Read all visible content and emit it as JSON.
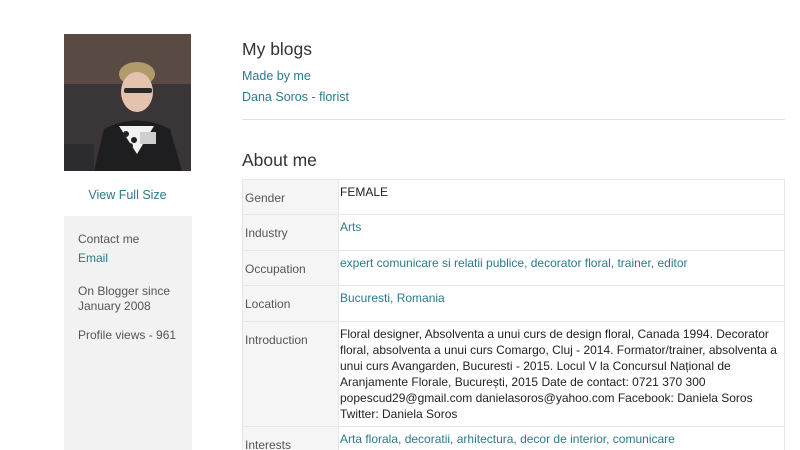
{
  "sidebar": {
    "view_full_size": "View Full Size",
    "contact_label": "Contact me",
    "email_link": "Email",
    "blogger_since_line1": "On Blogger since",
    "blogger_since_line2": "January 2008",
    "profile_views": "Profile views - 961"
  },
  "blogs": {
    "title": "My blogs",
    "items": [
      "Made by me",
      "Dana Soros - florist"
    ]
  },
  "about": {
    "title": "About me",
    "rows": [
      {
        "key": "Gender",
        "value": "FEMALE"
      },
      {
        "key": "Industry",
        "value": "Arts"
      },
      {
        "key": "Occupation",
        "value": "expert comunicare si relatii publice, decorator floral, trainer, editor"
      },
      {
        "key": "Location",
        "value": "Bucuresti, Romania"
      },
      {
        "key": "Introduction",
        "value": "Floral designer, Absolventa a unui curs de design floral, Canada 1994. Decorator floral, absolventa a unui curs Comargo, Cluj - 2014. Formator/trainer, absolventa a unui curs Avangarden, Bucuresti - 2015. Locul V la Concursul Național de Aranjamente Florale, București, 2015 Date de contact: 0721 370 300 popescud29@gmail.com danielasoros@yahoo.com Facebook: Daniela Soros Twitter: Daniela Soros"
      },
      {
        "key": "Interests",
        "value": "Arta florala, decoratii, arhitectura, decor de interior, comunicare"
      }
    ]
  },
  "colors": {
    "link": "#2a7a8c",
    "sidebar_bg": "#f2f2f2"
  }
}
